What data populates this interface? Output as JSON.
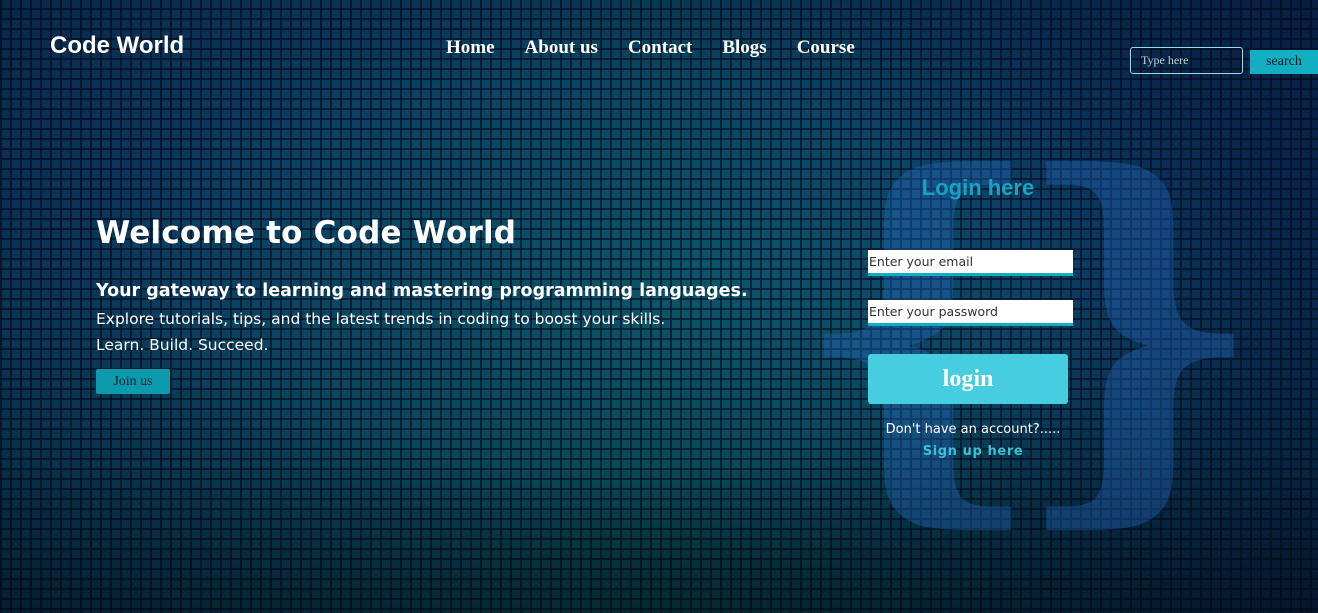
{
  "header": {
    "logo": "Code World",
    "nav": [
      "Home",
      "About us",
      "Contact",
      "Blogs",
      "Course"
    ],
    "search": {
      "placeholder": "Type here",
      "button_label": "search"
    }
  },
  "hero": {
    "title": "Welcome to Code World",
    "tagline": "Your gateway to learning and mastering programming languages.",
    "description": "Explore tutorials, tips, and the latest trends in coding to boost your skills.",
    "motto": "Learn. Build. Succeed.",
    "join_label": "Join us"
  },
  "login": {
    "title": "Login here",
    "email_placeholder": "Enter your email",
    "password_placeholder": "Enter your password",
    "button_label": "login",
    "signup_prompt": "Don't have an account?.....",
    "signup_link": "Sign up here"
  },
  "background": {
    "brace_left": "{",
    "brace_right": "}"
  },
  "colors": {
    "accent": "#13aec1",
    "login_button": "#47cde0",
    "login_title": "#17a3c1",
    "background": "#031326"
  }
}
